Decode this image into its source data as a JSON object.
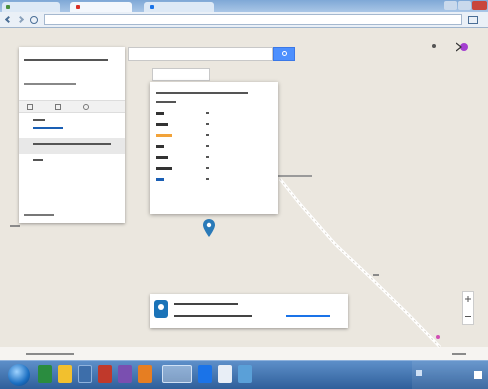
{
  "browser": {
    "tabs": [
      {
        "label": ""
      },
      {
        "label": ""
      },
      {
        "label": ""
      }
    ],
    "url": ""
  },
  "search": {
    "placeholder": "",
    "value": ""
  },
  "view_toggle": {
    "option_1": "",
    "option_2": ""
  },
  "left_panel": {
    "title": "",
    "subtitle": "",
    "toolbar_items": [
      "",
      "",
      ""
    ],
    "address_line": "",
    "phone_line": "",
    "selected_line": "",
    "selected_sub": "",
    "footer": ""
  },
  "info_popup": {
    "title": "",
    "subtitle": "",
    "rows": [
      {
        "label": "",
        "value": "",
        "color": "#333333"
      },
      {
        "label": "",
        "value": "",
        "color": "#333333"
      },
      {
        "label": "",
        "value": "",
        "color": "#f2a33a"
      },
      {
        "label": "",
        "value": "",
        "color": "#333333"
      },
      {
        "label": "",
        "value": "",
        "color": "#333333"
      },
      {
        "label": "",
        "value": "",
        "color": "#333333"
      },
      {
        "label": "",
        "value": "",
        "color": "#1a5fb4"
      }
    ]
  },
  "route_label": "",
  "bottom_bar": {
    "line_1": "",
    "line_2": "",
    "link": ""
  },
  "map_footer": "",
  "taskbar": {
    "clock": ""
  },
  "colors": {
    "search_button": "#4d90fe",
    "map_background": "#ebe7df",
    "route_line": "#ffffff",
    "accent_orange": "#f2a33a",
    "link_blue": "#1a73e8",
    "taskbar": "#3d6eaa"
  },
  "icons": {
    "search": "search-icon",
    "pin": "map-pin-icon",
    "start": "windows-start-icon",
    "zoom_in": "zoom-in-icon",
    "zoom_out": "zoom-out-icon"
  }
}
